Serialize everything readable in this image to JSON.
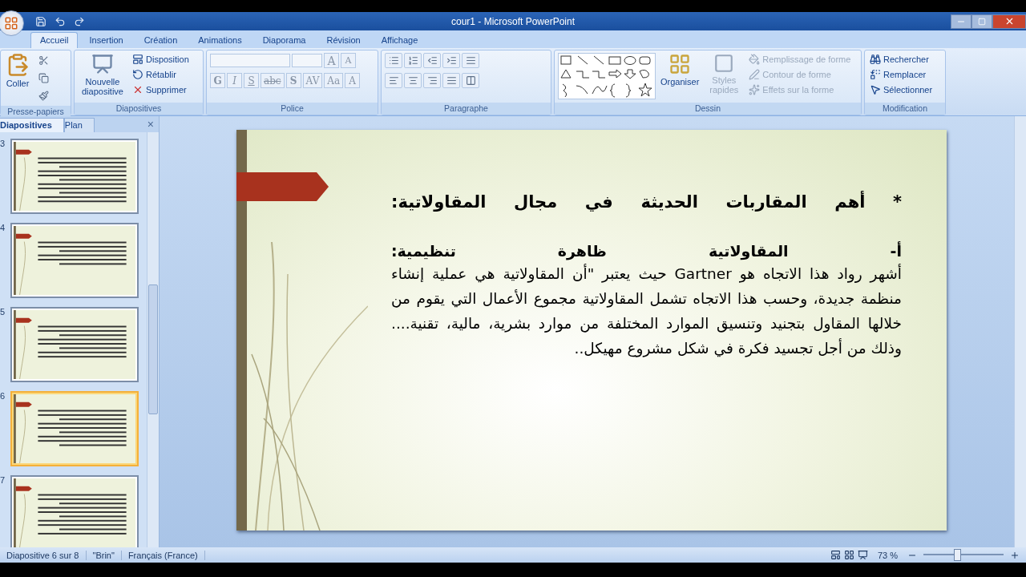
{
  "window": {
    "title": "cour1 - Microsoft PowerPoint"
  },
  "ribbon_tabs": [
    {
      "label": "Accueil",
      "selected": true
    },
    {
      "label": "Insertion",
      "selected": false
    },
    {
      "label": "Création",
      "selected": false
    },
    {
      "label": "Animations",
      "selected": false
    },
    {
      "label": "Diaporama",
      "selected": false
    },
    {
      "label": "Révision",
      "selected": false
    },
    {
      "label": "Affichage",
      "selected": false
    }
  ],
  "clipboard": {
    "title": "Presse-papiers",
    "paste": "Coller"
  },
  "slides_group": {
    "title": "Diapositives",
    "new_slide": "Nouvelle diapositive",
    "commands": [
      {
        "label": "Disposition",
        "disabled": false
      },
      {
        "label": "Rétablir",
        "disabled": false
      },
      {
        "label": "Supprimer",
        "disabled": false
      }
    ]
  },
  "font_group": {
    "title": "Police",
    "size_buttons": [
      "A",
      "A"
    ],
    "format_buttons": [
      "G",
      "I",
      "S",
      "abc",
      "S",
      "AV",
      "Aa"
    ],
    "color_button": "A"
  },
  "paragraph_group": {
    "title": "Paragraphe"
  },
  "drawing_group": {
    "title": "Dessin",
    "arrange": "Organiser",
    "quick_styles": {
      "label": "Styles rapides",
      "disabled": true
    },
    "commands": [
      {
        "label": "Remplissage de forme",
        "disabled": true
      },
      {
        "label": "Contour de forme",
        "disabled": true
      },
      {
        "label": "Effets sur la forme",
        "disabled": true
      }
    ]
  },
  "editing_group": {
    "title": "Modification",
    "commands": [
      {
        "label": "Rechercher"
      },
      {
        "label": "Remplacer"
      },
      {
        "label": "Sélectionner"
      }
    ]
  },
  "panel": {
    "tabs": [
      {
        "label": "Diapositives",
        "selected": true
      },
      {
        "label": "Plan",
        "selected": false
      }
    ],
    "close": "×",
    "thumbnails": [
      {
        "number": "3",
        "selected": false
      },
      {
        "number": "4",
        "selected": false
      },
      {
        "number": "5",
        "selected": false
      },
      {
        "number": "6",
        "selected": true
      },
      {
        "number": "7",
        "selected": false
      }
    ]
  },
  "slide": {
    "title": "* أهم المقاربات الحديثة في مجال المقاولاتية:",
    "subtitle": "أ- المقاولاتية ظاهرة تنظيمية:",
    "body": "أشهر رواد هذا الاتجاه هو Gartner حيث يعتبر \"أن المقاولاتية هي عملية إنشاء منظمة جديدة، وحسب هذا الاتجاه تشمل المقاولاتية مجموع الأعمال التي يقوم من خلالها المقاول بتجنيد وتنسيق الموارد المختلفة من موارد بشرية، مالية، تقنية.... وذلك من أجل تجسيد فكرة في شكل مشروع مهيكل.."
  },
  "status_bar": {
    "slide": "Diapositive 6 sur 8",
    "theme": "\"Brin\"",
    "language": "Français (France)",
    "zoom": "73 %",
    "zoom_slider": {
      "level": 0.42
    }
  }
}
